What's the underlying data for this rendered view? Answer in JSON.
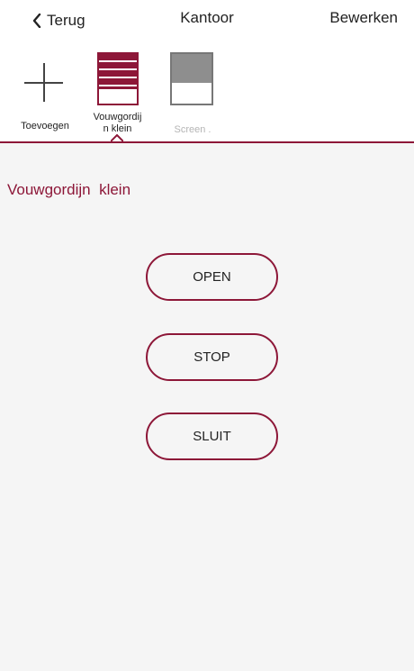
{
  "colors": {
    "accent": "#8d1738",
    "background": "#f5f5f5",
    "text": "#222222",
    "muted": "#b5b5b5"
  },
  "header": {
    "back_label": "Terug",
    "title": "Kantoor",
    "edit_label": "Bewerken"
  },
  "devices": {
    "add_label": "Toevoegen",
    "items": [
      {
        "label_line_1": "Vouwgordij",
        "label_line_2": "n  klein",
        "icon": "folding-blind-icon",
        "selected": true
      },
      {
        "label": "Screen .",
        "icon": "screen-icon",
        "selected": false
      }
    ]
  },
  "main": {
    "device_name": "Vouwgordijn  klein",
    "buttons": {
      "open": "OPEN",
      "stop": "STOP",
      "close": "SLUIT"
    }
  }
}
